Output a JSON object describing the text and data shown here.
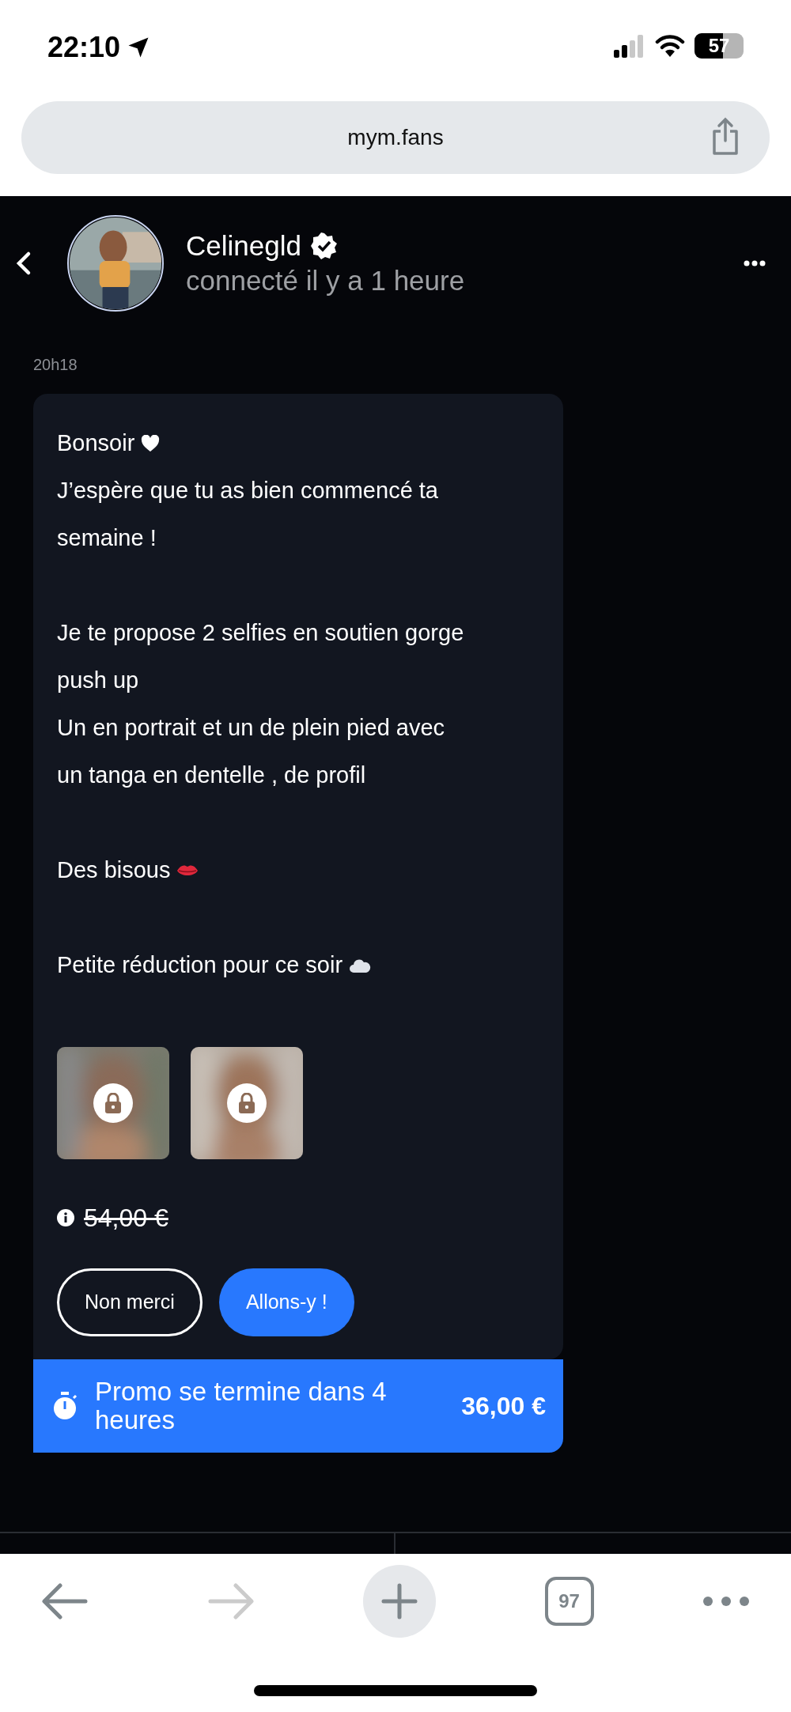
{
  "status_bar": {
    "time": "22:10",
    "battery": "57"
  },
  "browser": {
    "url": "mym.fans",
    "tab_count": "97",
    "back_disabled": false,
    "forward_disabled": true
  },
  "chat_header": {
    "name": "Celinegld",
    "verified": true,
    "presence": "connecté il y a 1 heure"
  },
  "timestamp": "20h18",
  "message": {
    "paragraphs": [
      {
        "lines": [
          {
            "text": "Bonsoir",
            "kind": "heart"
          },
          {
            "text": "J’espère que tu as bien commencé ta"
          },
          {
            "text": "semaine !"
          }
        ]
      },
      {
        "lines": [
          {
            "text": "Je te propose 2 selfies en soutien gorge"
          },
          {
            "text": "push up"
          },
          {
            "text": "Un en portrait et un de plein pied avec"
          },
          {
            "text": "un tanga en dentelle , de profil"
          }
        ]
      },
      {
        "lines": [
          {
            "text": "Des bisous",
            "kind": "lips"
          }
        ]
      },
      {
        "lines": [
          {
            "text": "Petite réduction pour ce soir",
            "kind": "cloud"
          }
        ]
      }
    ],
    "media": [
      {
        "locked": true
      },
      {
        "locked": true
      }
    ],
    "old_price": "54,00 €",
    "buttons": [
      {
        "label": "Non merci",
        "kind": "outline"
      },
      {
        "label": "Allons-y !",
        "kind": "primary"
      }
    ]
  },
  "promo": {
    "text": "Promo se termine dans 4 heures",
    "price": "36,00 €"
  }
}
